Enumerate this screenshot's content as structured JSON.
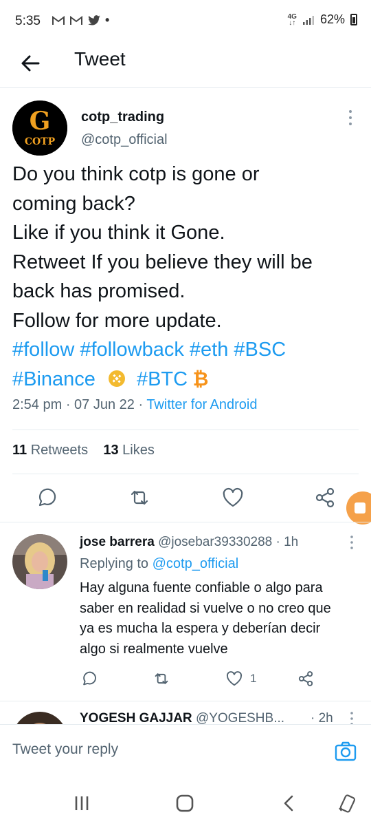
{
  "status_bar": {
    "time": "5:35",
    "notification_icons": [
      "M",
      "M",
      "twitter-bird",
      "•"
    ],
    "network": "4G",
    "battery": "62%"
  },
  "header": {
    "title": "Tweet"
  },
  "tweet": {
    "author_name": "cotp_trading",
    "author_handle": "@cotp_official",
    "avatar_text": "COTP",
    "avatar_letter": "G",
    "lines": [
      "Do you think cotp is gone or",
      "coming back?",
      "Like if you think it Gone.",
      "Retweet If you believe they will be",
      "back has promised.",
      "Follow for more update."
    ],
    "hashtags_line1": "#follow #followback #eth #BSC",
    "hashtag_binance": "#Binance",
    "hashtag_btc": "#BTC",
    "timestamp": "2:54 pm · 07 Jun 22 · ",
    "source": "Twitter for Android",
    "retweets_count": "11",
    "retweets_label": "Retweets",
    "likes_count": "13",
    "likes_label": "Likes"
  },
  "replies": [
    {
      "name": "jose barrera",
      "handle": "@josebar39330288 · 1h",
      "replying_prefix": "Replying to ",
      "replying_to": "@cotp_official",
      "text_lines": [
        "Hay alguna fuente confiable o algo para",
        "saber en realidad si vuelve o no creo que",
        "ya es mucha la espera y deberían decir",
        "algo si realmente vuelve"
      ],
      "likes": "1"
    },
    {
      "name": "YOGESH GAJJAR",
      "handle": "@YOGESHB...",
      "time": "· 2h"
    }
  ],
  "composer": {
    "placeholder": "Tweet your reply"
  },
  "colors": {
    "accent": "#1d9bf0",
    "secondary_text": "#536471",
    "avatar_gold": "#f0a020"
  }
}
